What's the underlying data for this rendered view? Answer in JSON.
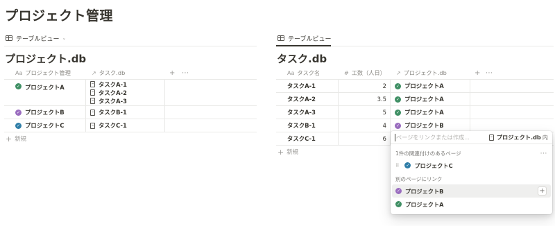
{
  "page": {
    "title": "プロジェクト管理"
  },
  "left": {
    "view_tab": "テーブルビュー",
    "db_title": "プロジェクト.db",
    "columns": {
      "name": "プロジェクト管理",
      "relation": "タスク.db"
    },
    "rows": [
      {
        "name": "プロジェクトA",
        "color": "#3f8f64",
        "tasks": [
          "タスクA-1",
          "タスクA-2",
          "タスクA-3"
        ]
      },
      {
        "name": "プロジェクトB",
        "color": "#9a6dbf",
        "tasks": [
          "タスクB-1"
        ]
      },
      {
        "name": "プロジェクトC",
        "color": "#2f7ea8",
        "tasks": [
          "タスクC-1"
        ]
      }
    ],
    "new_label": "新規"
  },
  "right": {
    "view_tab": "テーブルビュー",
    "db_title": "タスク.db",
    "columns": {
      "name": "タスク名",
      "effort": "工数（人日）",
      "relation": "プロジェクト.db"
    },
    "rows": [
      {
        "name": "タスクA-1",
        "effort": "2",
        "project": "プロジェクトA",
        "color": "#3f8f64"
      },
      {
        "name": "タスクA-2",
        "effort": "3.5",
        "project": "プロジェクトA",
        "color": "#3f8f64"
      },
      {
        "name": "タスクA-3",
        "effort": "5",
        "project": "プロジェクトA",
        "color": "#3f8f64"
      },
      {
        "name": "タスクB-1",
        "effort": "4",
        "project": "プロジェクトB",
        "color": "#9a6dbf"
      },
      {
        "name": "タスクC-1",
        "effort": "6",
        "project": "",
        "color": ""
      }
    ],
    "new_label": "新規"
  },
  "popup": {
    "search_placeholder": "ページをリンクまたは作成...",
    "db_tag": "プロジェクト.db",
    "db_tag_suffix": "内",
    "linked_section": "1件の関連付けのあるページ",
    "linked": [
      {
        "name": "プロジェクトC",
        "color": "#2f7ea8"
      }
    ],
    "other_section": "別のページにリンク",
    "others": [
      {
        "name": "プロジェクトB",
        "color": "#9a6dbf"
      },
      {
        "name": "プロジェクトA",
        "color": "#3f8f64"
      }
    ]
  }
}
